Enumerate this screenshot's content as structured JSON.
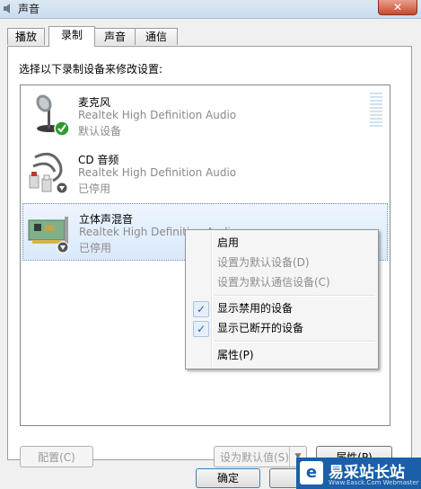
{
  "window": {
    "title": "声音",
    "close": "✕"
  },
  "tabs": [
    "播放",
    "录制",
    "声音",
    "通信"
  ],
  "instruction": "选择以下录制设备来修改设置:",
  "devices": [
    {
      "name": "麦克风",
      "driver": "Realtek High Definition Audio",
      "status": "默认设备"
    },
    {
      "name": "CD 音频",
      "driver": "Realtek High Definition Audio",
      "status": "已停用"
    },
    {
      "name": "立体声混音",
      "driver": "Realtek High Definition Audio",
      "status": "已停用"
    }
  ],
  "context_menu": {
    "items": [
      {
        "label": "启用"
      },
      {
        "label": "设置为默认设备(D)"
      },
      {
        "label": "设置为默认通信设备(C)"
      },
      {
        "label": "显示禁用的设备"
      },
      {
        "label": "显示已断开的设备"
      },
      {
        "label": "属性(P)"
      }
    ],
    "check": "✓"
  },
  "buttons": {
    "configure": "配置(C)",
    "set_default": "设为默认值(S)",
    "properties": "属性(P)",
    "ok": "确定",
    "cancel": "取"
  },
  "watermark": {
    "text": "易采站长站",
    "sub": "Www.Easck.Com  Webmaster"
  }
}
